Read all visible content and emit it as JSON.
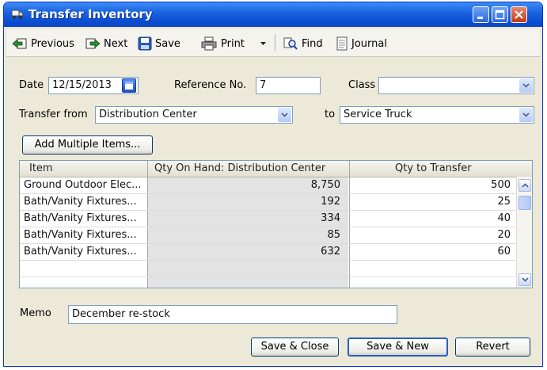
{
  "window": {
    "title": "Transfer Inventory",
    "accent_color": "#0a4cd1"
  },
  "toolbar": {
    "previous_label": "Previous",
    "next_label": "Next",
    "save_label": "Save",
    "print_label": "Print",
    "find_label": "Find",
    "journal_label": "Journal"
  },
  "form": {
    "date_label": "Date",
    "date_value": "12/15/2013",
    "reference_label": "Reference No.",
    "reference_value": "7",
    "class_label": "Class",
    "class_value": "",
    "transfer_from_label": "Transfer from",
    "transfer_from_value": "Distribution Center",
    "to_label": "to",
    "to_value": "Service Truck",
    "add_multiple_label": "Add Multiple Items..."
  },
  "grid": {
    "headers": [
      "Item",
      "Qty On Hand: Distribution Center",
      "Qty to Transfer"
    ],
    "rows": [
      {
        "item": "Ground Outdoor Elec...",
        "on_hand": "8,750",
        "transfer": "500"
      },
      {
        "item": "Bath/Vanity Fixtures...",
        "on_hand": "192",
        "transfer": "25"
      },
      {
        "item": "Bath/Vanity Fixtures...",
        "on_hand": "334",
        "transfer": "40"
      },
      {
        "item": "Bath/Vanity Fixtures...",
        "on_hand": "85",
        "transfer": "20"
      },
      {
        "item": "Bath/Vanity Fixtures...",
        "on_hand": "632",
        "transfer": "60"
      }
    ]
  },
  "memo": {
    "label": "Memo",
    "value": "December re-stock"
  },
  "buttons": {
    "save_close": "Save & Close",
    "save_new": "Save & New",
    "revert": "Revert"
  }
}
